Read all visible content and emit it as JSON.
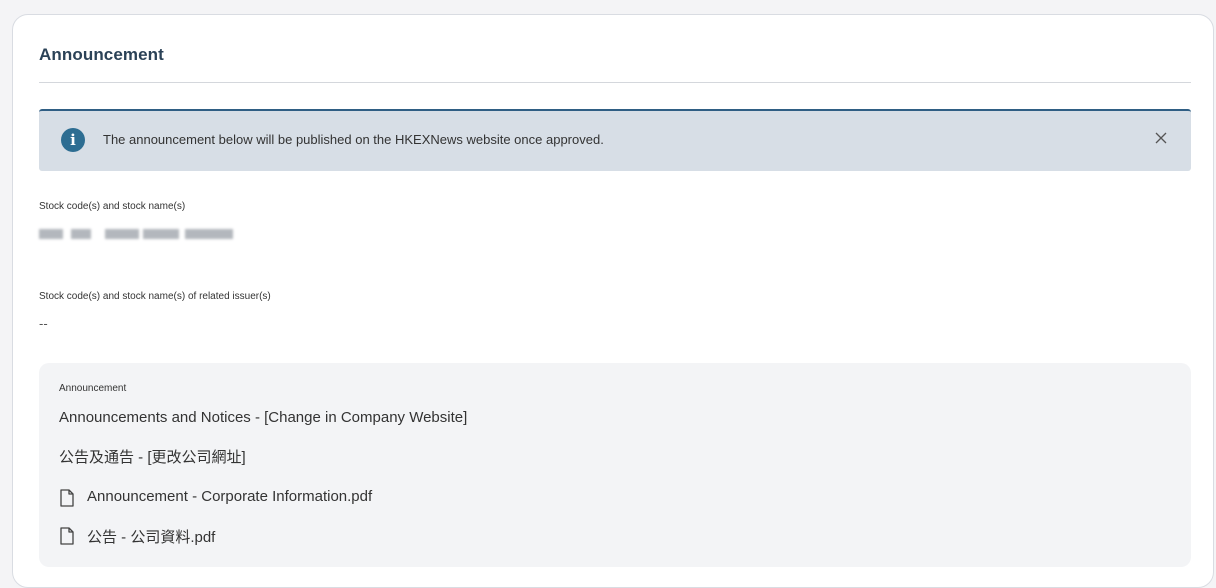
{
  "card": {
    "title": "Announcement"
  },
  "info_banner": {
    "icon": "info-icon",
    "icon_glyph": "i",
    "message": "The announcement below will be published on the HKEXNews website once approved.",
    "close_icon": "close-icon",
    "accent_color": "#2d6d92",
    "background_color": "#d7dee6"
  },
  "stock": {
    "label": "Stock code(s) and stock name(s)",
    "value_redacted": true
  },
  "related_issuer": {
    "label": "Stock code(s) and stock name(s) of related issuer(s)",
    "value": "--"
  },
  "announcement": {
    "label": "Announcement",
    "headline_en": "Announcements and Notices - [Change in Company Website]",
    "headline_zh": "公告及通告 - [更改公司網址]",
    "files": [
      {
        "icon": "file-icon",
        "name": "Announcement - Corporate Information.pdf"
      },
      {
        "icon": "file-icon",
        "name": "公告 - 公司資料.pdf"
      }
    ]
  }
}
